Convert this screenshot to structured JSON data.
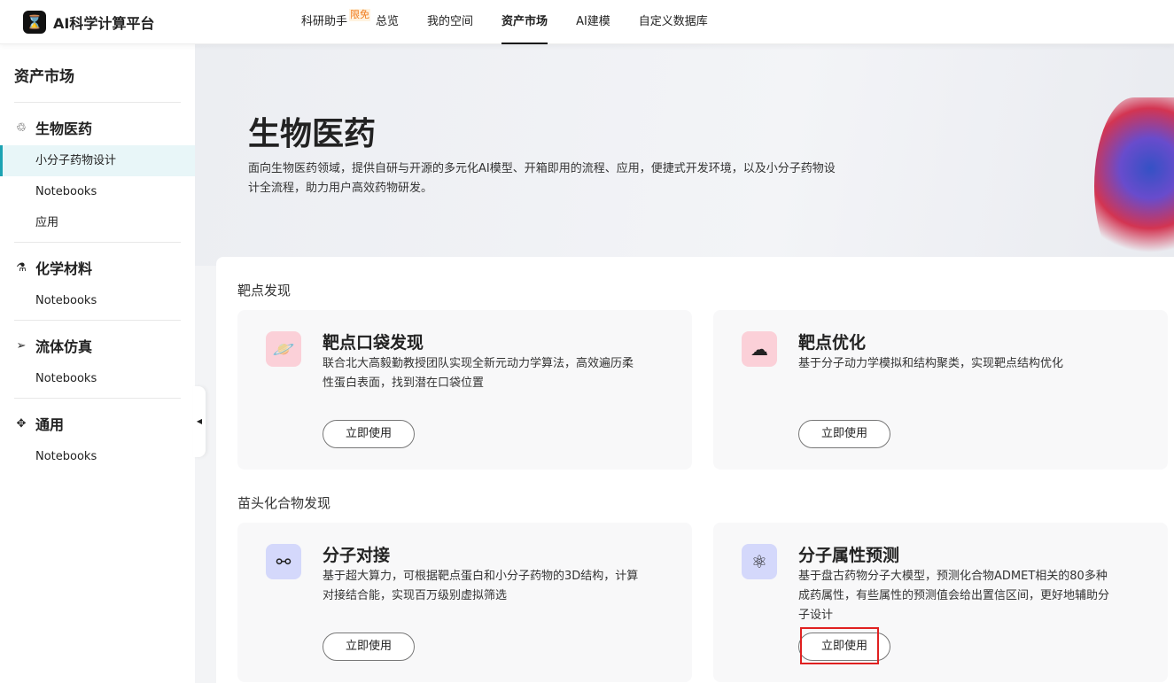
{
  "app": {
    "title": "AI科学计算平台",
    "logo_glyph": "⌛"
  },
  "nav": {
    "items": [
      {
        "label": "科研助手",
        "badge": "限免"
      },
      {
        "label": "总览"
      },
      {
        "label": "我的空间"
      },
      {
        "label": "资产市场",
        "active": true
      },
      {
        "label": "AI建模"
      },
      {
        "label": "自定义数据库"
      }
    ]
  },
  "sidebar": {
    "title": "资产市场",
    "groups": [
      {
        "label": "生物医药",
        "icon": "virus-icon",
        "glyph": "♲",
        "items": [
          "小分子药物设计",
          "Notebooks",
          "应用"
        ]
      },
      {
        "label": "化学材料",
        "icon": "flask-icon",
        "glyph": "⚗",
        "items": [
          "Notebooks"
        ]
      },
      {
        "label": "流体仿真",
        "icon": "flow-icon",
        "glyph": "➢",
        "items": [
          "Notebooks"
        ]
      },
      {
        "label": "通用",
        "icon": "nodes-icon",
        "glyph": "✥",
        "items": [
          "Notebooks"
        ]
      }
    ]
  },
  "hero": {
    "title": "生物医药",
    "desc": "面向生物医药领域，提供自研与开源的多元化AI模型、开箱即用的流程、应用，便捷式开发环境，以及小分子药物设计全流程，助力用户高效药物研发。"
  },
  "sections": [
    {
      "title": "靶点发现",
      "cards": [
        {
          "title": "靶点口袋发现",
          "desc": "联合北大高毅勤教授团队实现全新元动力学算法，高效遍历柔性蛋白表面，找到潜在口袋位置",
          "button": "立即使用",
          "icon": "planet-icon",
          "glyph": "🪐",
          "color": "#fbd0d8"
        },
        {
          "title": "靶点优化",
          "desc": "基于分子动力学模拟和结构聚类，实现靶点结构优化",
          "button": "立即使用",
          "icon": "protein-icon",
          "glyph": "☁",
          "color": "#fbd0d8"
        }
      ]
    },
    {
      "title": "苗头化合物发现",
      "cards": [
        {
          "title": "分子对接",
          "desc": "基于超大算力，可根据靶点蛋白和小分子药物的3D结构，计算对接结合能，实现百万级别虚拟筛选",
          "button": "立即使用",
          "icon": "docking-icon",
          "glyph": "⚯",
          "color": "#d4d8fb"
        },
        {
          "title": "分子属性预测",
          "desc": "基于盘古药物分子大模型，预测化合物ADMET相关的80多种成药属性，有些属性的预测值会给出置信区间，更好地辅助分子设计",
          "button": "立即使用",
          "icon": "molecule-icon",
          "glyph": "⚛",
          "color": "#d4d8fb"
        }
      ]
    }
  ]
}
